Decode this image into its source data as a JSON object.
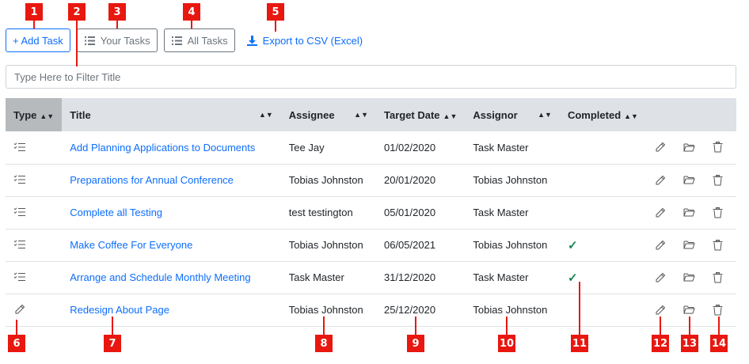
{
  "markers": [
    "1",
    "2",
    "3",
    "4",
    "5",
    "6",
    "7",
    "8",
    "9",
    "10",
    "11",
    "12",
    "13",
    "14"
  ],
  "toolbar": {
    "add_task": "+ Add Task",
    "your_tasks": "Your Tasks",
    "all_tasks": "All Tasks",
    "export": "Export to CSV (Excel)"
  },
  "filter": {
    "placeholder": "Type Here to Filter Title"
  },
  "table": {
    "headers": {
      "type": "Type",
      "title": "Title",
      "assignee": "Assignee",
      "target_date": "Target Date",
      "assignor": "Assignor",
      "completed": "Completed"
    },
    "rows": [
      {
        "type_icon": "checklist-icon",
        "title": "Add Planning Applications to Documents",
        "assignee": "Tee Jay",
        "target_date": "01/02/2020",
        "assignor": "Task Master",
        "completed": ""
      },
      {
        "type_icon": "checklist-icon",
        "title": "Preparations for Annual Conference",
        "assignee": "Tobias Johnston",
        "target_date": "20/01/2020",
        "assignor": "Tobias Johnston",
        "completed": ""
      },
      {
        "type_icon": "checklist-icon",
        "title": "Complete all Testing",
        "assignee": "test testington",
        "target_date": "05/01/2020",
        "assignor": "Task Master",
        "completed": ""
      },
      {
        "type_icon": "checklist-icon",
        "title": "Make Coffee For Everyone",
        "assignee": "Tobias Johnston",
        "target_date": "06/05/2021",
        "assignor": "Tobias Johnston",
        "completed": "✓"
      },
      {
        "type_icon": "checklist-icon",
        "title": "Arrange and Schedule Monthly Meeting",
        "assignee": "Task Master",
        "target_date": "31/12/2020",
        "assignor": "Task Master",
        "completed": "✓"
      },
      {
        "type_icon": "pencil-icon",
        "title": "Redesign About Page",
        "assignee": "Tobias Johnston",
        "target_date": "25/12/2020",
        "assignor": "Tobias Johnston",
        "completed": ""
      }
    ]
  },
  "colors": {
    "marker": "#e8170f",
    "primary": "#0d6efd",
    "success": "#198754",
    "header_bg": "#dee2e6"
  }
}
